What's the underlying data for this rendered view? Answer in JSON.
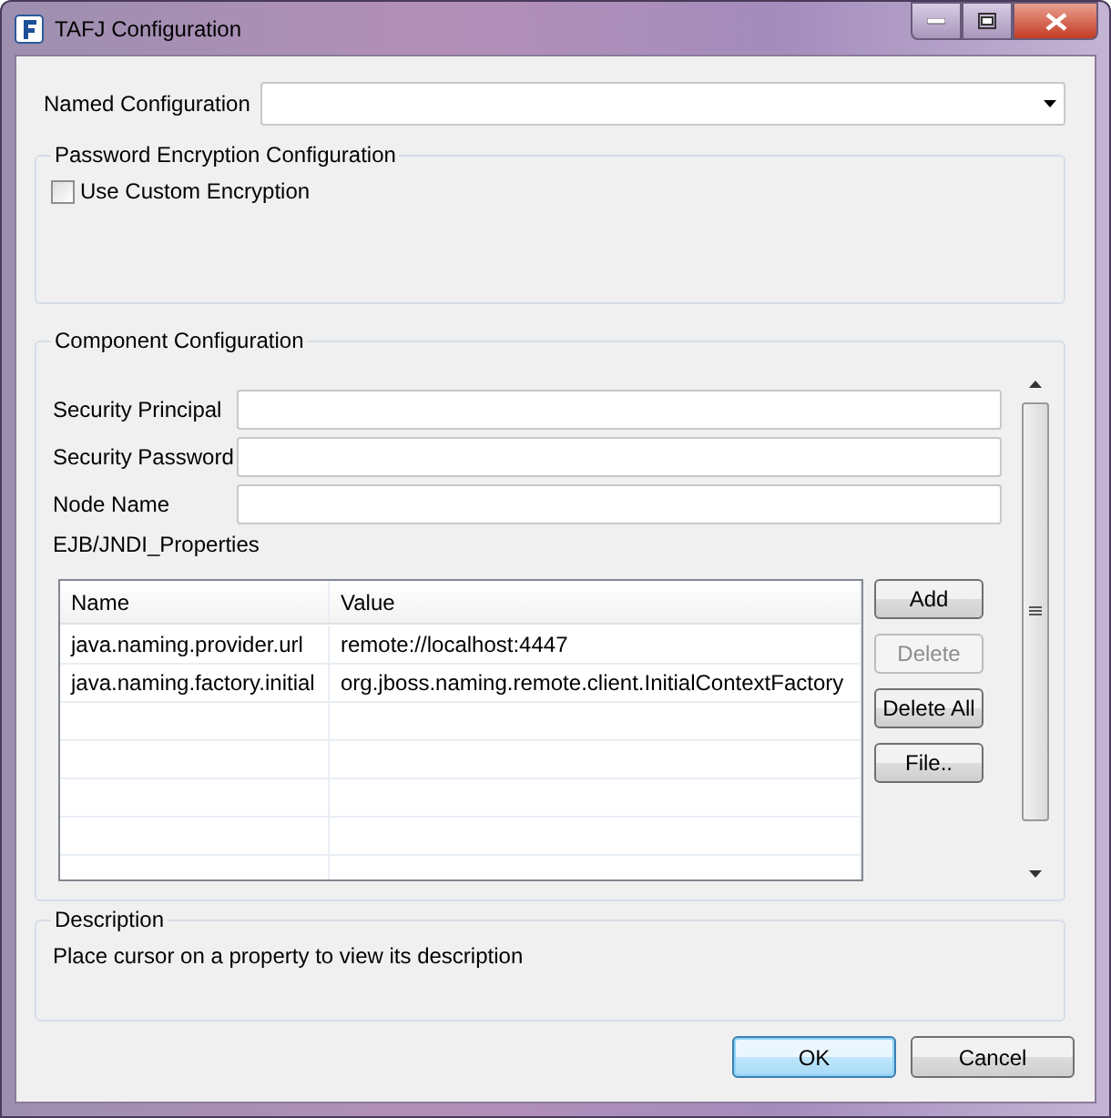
{
  "window": {
    "title": "TAFJ Configuration"
  },
  "named_configuration": {
    "label": "Named Configuration"
  },
  "password_group": {
    "title": "Password Encryption Configuration",
    "checkbox": {
      "label": "Use Custom Encryption",
      "checked": false
    }
  },
  "component_group": {
    "title": "Component Configuration",
    "fields": [
      {
        "label": "Security Principal"
      },
      {
        "label": "Security Password"
      },
      {
        "label": "Node Name"
      }
    ],
    "properties_label": "EJB/JNDI_Properties",
    "table": {
      "columns": [
        "Name",
        "Value"
      ],
      "rows": [
        [
          "java.naming.provider.url",
          "remote://localhost:4447"
        ],
        [
          "java.naming.factory.initial",
          "org.jboss.naming.remote.client.InitialContextFactory"
        ]
      ]
    },
    "buttons": [
      {
        "label": "Add",
        "disabled": false
      },
      {
        "label": "Delete",
        "disabled": true
      },
      {
        "label": "Delete All",
        "disabled": false
      },
      {
        "label": "File..",
        "disabled": false
      }
    ]
  },
  "description": {
    "title": "Description",
    "text": "Place cursor on a property to view its description"
  },
  "buttons": [
    {
      "label": "OK",
      "default": true
    },
    {
      "label": "Cancel",
      "default": false
    }
  ]
}
